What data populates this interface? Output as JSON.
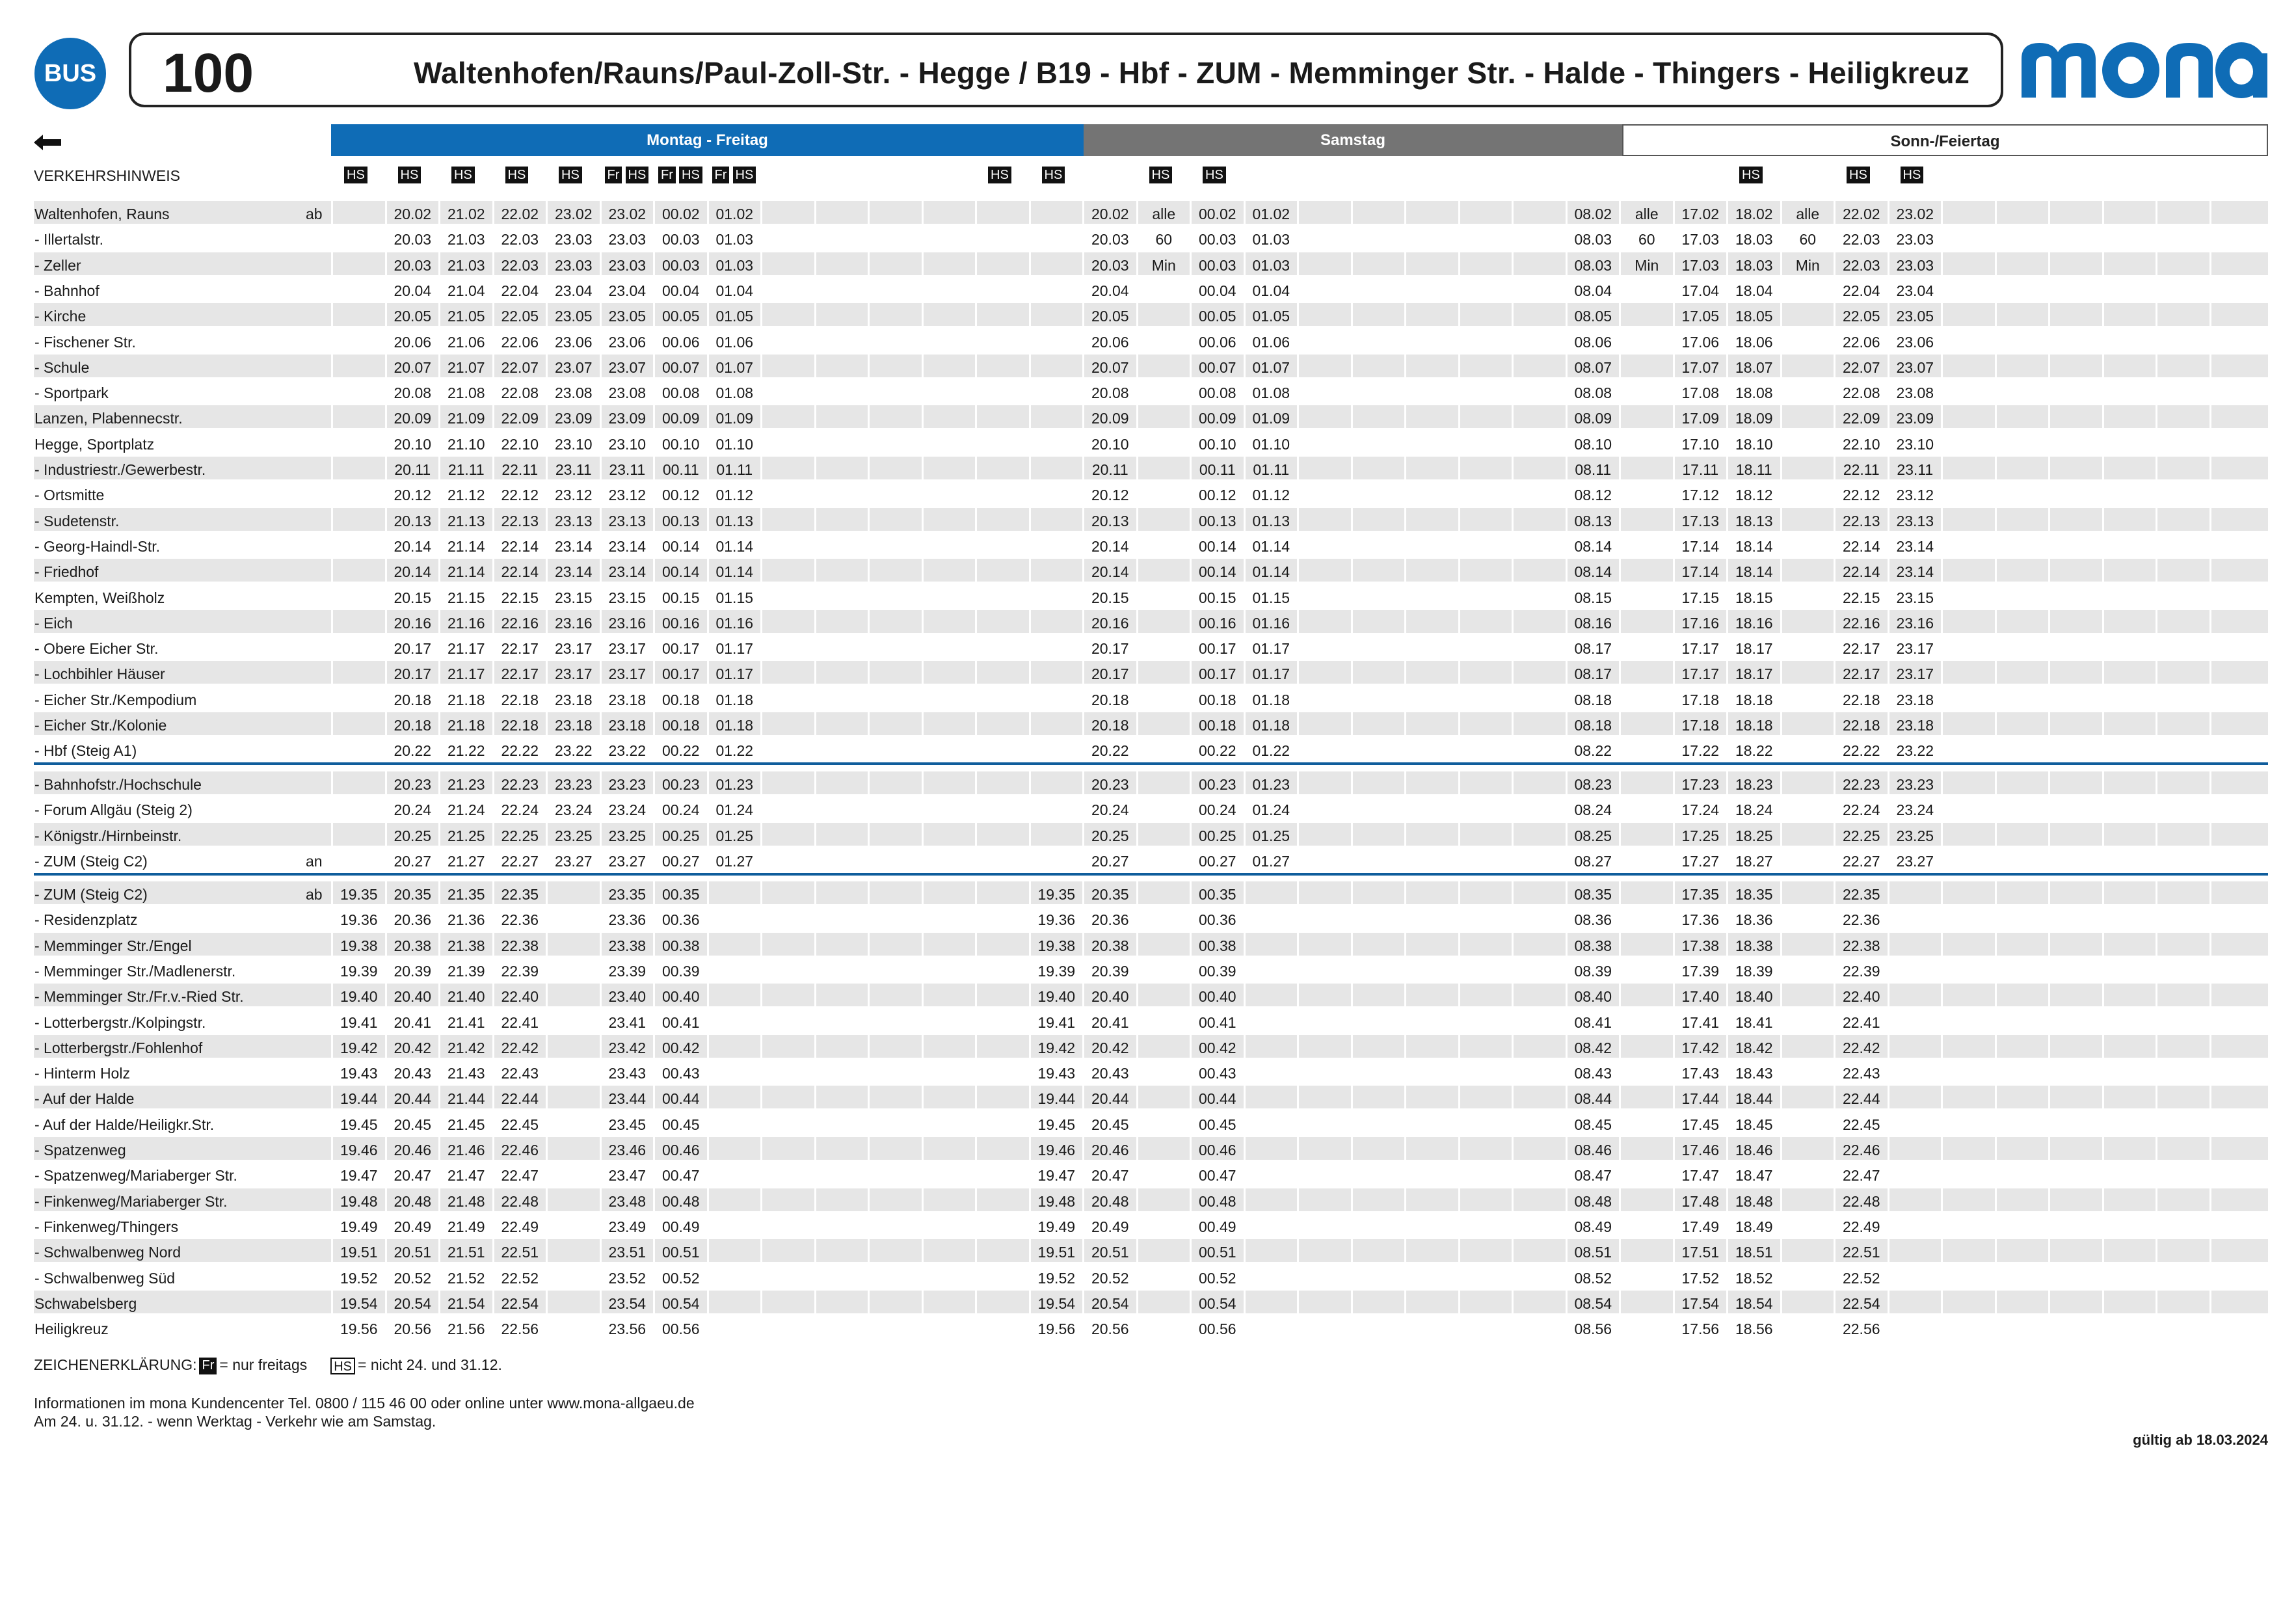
{
  "header": {
    "badge": "BUS",
    "line_number": "100",
    "route_title": "Waltenhofen/Rauns/Paul-Zoll-Str. - Hegge / B19 - Hbf - ZUM - Memminger Str. - Halde - Thingers - Heiligkreuz",
    "brand": "mona",
    "brand_color": "#0f6cb6"
  },
  "day_headers": {
    "weekday": "Montag - Freitag",
    "saturday": "Samstag",
    "sunday": "Sonn-/Feiertag"
  },
  "notes_label": "VERKEHRSHINWEIS",
  "hs_tag": "HS",
  "fr_tag": "Fr",
  "stops": [
    "Waltenhofen, Rauns",
    "- Illertalstr.",
    "- Zeller",
    "- Bahnhof",
    "- Kirche",
    "- Fischener Str.",
    "- Schule",
    "- Sportpark",
    "Lanzen, Plabennecstr.",
    "Hegge, Sportplatz",
    "- Industriestr./Gewerbestr.",
    "- Ortsmitte",
    "- Sudetenstr.",
    "- Georg-Haindl-Str.",
    "- Friedhof",
    "Kempten, Weißholz",
    "- Eich",
    "- Obere Eicher Str.",
    "- Lochbihler Häuser",
    "- Eicher Str./Kempodium",
    "- Eicher Str./Kolonie",
    "- Hbf (Steig A1)",
    "- Bahnhofstr./Hochschule",
    "- Forum Allgäu (Steig 2)",
    "- Königstr./Hirnbeinstr.",
    "- ZUM (Steig C2)",
    "- ZUM (Steig C2)",
    "- Residenzplatz",
    "- Memminger Str./Engel",
    "- Memminger Str./Madlenerstr.",
    "- Memminger Str./Fr.v.-Ried Str.",
    "- Lotterbergstr./Kolpingstr.",
    "- Lotterbergstr./Fohlenhof",
    "- Hinterm Holz",
    "- Auf der Halde",
    "- Auf der Halde/Heiligkr.Str.",
    "- Spatzenweg",
    "- Spatzenweg/Mariaberger Str.",
    "- Finkenweg/Mariaberger Str.",
    "- Finkenweg/Thingers",
    "- Schwalbenweg Nord",
    "- Schwalbenweg Süd",
    "Schwabelsberg",
    "Heiligkreuz"
  ],
  "ab_an": [
    "ab",
    "",
    "",
    "",
    "",
    "",
    "",
    "",
    "",
    "",
    "",
    "",
    "",
    "",
    "",
    "",
    "",
    "",
    "",
    "",
    "",
    "",
    "",
    "",
    "",
    "an",
    "ab",
    "",
    "",
    "",
    "",
    "",
    "",
    "",
    "",
    "",
    "",
    "",
    "",
    "",
    "",
    "",
    "",
    ""
  ],
  "weekday_times": [
    [
      "20.02",
      "20.03",
      "20.03",
      "20.04",
      "20.05",
      "20.06",
      "20.07",
      "20.08",
      "20.09",
      "20.10",
      "20.11",
      "20.12",
      "20.13",
      "20.14",
      "20.14",
      "20.15",
      "20.16",
      "20.17",
      "20.17",
      "20.18",
      "20.18",
      "20.22",
      "20.23",
      "20.24",
      "20.25",
      "20.27",
      "20.35",
      "20.36",
      "20.38",
      "20.39",
      "20.40",
      "20.41",
      "20.42",
      "20.43",
      "20.44",
      "20.45",
      "20.46",
      "20.47",
      "20.48",
      "20.49",
      "20.51",
      "20.52",
      "20.54",
      "20.56"
    ],
    [
      "21.02",
      "21.03",
      "21.03",
      "21.04",
      "21.05",
      "21.06",
      "21.07",
      "21.08",
      "21.09",
      "21.10",
      "21.11",
      "21.12",
      "21.13",
      "21.14",
      "21.14",
      "21.15",
      "21.16",
      "21.17",
      "21.17",
      "21.18",
      "21.18",
      "21.22",
      "21.23",
      "21.24",
      "21.25",
      "21.27",
      "21.35",
      "21.36",
      "21.38",
      "21.39",
      "21.40",
      "21.41",
      "21.42",
      "21.43",
      "21.44",
      "21.45",
      "21.46",
      "21.47",
      "21.48",
      "21.49",
      "21.51",
      "21.52",
      "21.54",
      "21.56"
    ],
    [
      "22.02",
      "22.03",
      "22.03",
      "22.04",
      "22.05",
      "22.06",
      "22.07",
      "22.08",
      "22.09",
      "22.10",
      "22.11",
      "22.12",
      "22.13",
      "22.14",
      "22.14",
      "22.15",
      "22.16",
      "22.17",
      "22.17",
      "22.18",
      "22.18",
      "22.22",
      "22.23",
      "22.24",
      "22.25",
      "22.27",
      "22.35",
      "22.36",
      "22.38",
      "22.39",
      "22.40",
      "22.41",
      "22.42",
      "22.43",
      "22.44",
      "22.45",
      "22.46",
      "22.47",
      "22.48",
      "22.49",
      "22.51",
      "22.52",
      "22.54",
      "22.56"
    ],
    [
      "23.02",
      "23.03",
      "23.03",
      "23.04",
      "23.05",
      "23.06",
      "23.07",
      "23.08",
      "23.09",
      "23.10",
      "23.11",
      "23.12",
      "23.13",
      "23.14",
      "23.14",
      "23.15",
      "23.16",
      "23.17",
      "23.17",
      "23.18",
      "23.18",
      "23.22",
      "23.23",
      "23.24",
      "23.25",
      "23.27",
      "",
      "",
      "",
      "",
      "",
      "",
      "",
      "",
      "",
      "",
      "",
      "",
      "",
      "",
      "",
      "",
      "",
      ""
    ],
    [
      "23.02",
      "23.03",
      "23.03",
      "23.04",
      "23.05",
      "23.06",
      "23.07",
      "23.08",
      "23.09",
      "23.10",
      "23.11",
      "23.12",
      "23.13",
      "23.14",
      "23.14",
      "23.15",
      "23.16",
      "23.17",
      "23.17",
      "23.18",
      "23.18",
      "23.22",
      "23.23",
      "23.24",
      "23.25",
      "23.27",
      "23.35",
      "23.36",
      "23.38",
      "23.39",
      "23.40",
      "23.41",
      "23.42",
      "23.43",
      "23.44",
      "23.45",
      "23.46",
      "23.47",
      "23.48",
      "23.49",
      "23.51",
      "23.52",
      "23.54",
      "23.56"
    ],
    [
      "00.02",
      "00.03",
      "00.03",
      "00.04",
      "00.05",
      "00.06",
      "00.07",
      "00.08",
      "00.09",
      "00.10",
      "00.11",
      "00.12",
      "00.13",
      "00.14",
      "00.14",
      "00.15",
      "00.16",
      "00.17",
      "00.17",
      "00.18",
      "00.18",
      "00.22",
      "00.23",
      "00.24",
      "00.25",
      "00.27",
      "00.35",
      "00.36",
      "00.38",
      "00.39",
      "00.40",
      "00.41",
      "00.42",
      "00.43",
      "00.44",
      "00.45",
      "00.46",
      "00.47",
      "00.48",
      "00.49",
      "00.51",
      "00.52",
      "00.54",
      "00.56"
    ],
    [
      "01.02",
      "01.03",
      "01.03",
      "01.04",
      "01.05",
      "01.06",
      "01.07",
      "01.08",
      "01.09",
      "01.10",
      "01.11",
      "01.12",
      "01.13",
      "01.14",
      "01.14",
      "01.15",
      "01.16",
      "01.17",
      "01.17",
      "01.18",
      "01.18",
      "01.22",
      "01.23",
      "01.24",
      "01.25",
      "01.27",
      "",
      "",
      "",
      "",
      "",
      "",
      "",
      "",
      "",
      "",
      "",
      "",
      "",
      "",
      "",
      "",
      "",
      ""
    ]
  ],
  "weekday_early": [
    "",
    "",
    "",
    "",
    "",
    "",
    "",
    "",
    "",
    "",
    "",
    "",
    "",
    "",
    "",
    "",
    "",
    "",
    "",
    "",
    "",
    "",
    "",
    "",
    "",
    "",
    "19.35",
    "19.36",
    "19.38",
    "19.39",
    "19.40",
    "19.41",
    "19.42",
    "19.43",
    "19.44",
    "19.45",
    "19.46",
    "19.47",
    "19.48",
    "19.49",
    "19.51",
    "19.52",
    "19.54",
    "19.56"
  ],
  "saturday_times": [
    [
      "",
      "",
      "",
      "",
      "",
      "",
      "",
      "",
      "",
      "",
      "",
      "",
      "",
      "",
      "",
      "",
      "",
      "",
      "",
      "",
      "",
      "",
      "",
      "",
      "",
      "",
      "19.35",
      "19.36",
      "19.38",
      "19.39",
      "19.40",
      "19.41",
      "19.42",
      "19.43",
      "19.44",
      "19.45",
      "19.46",
      "19.47",
      "19.48",
      "19.49",
      "19.51",
      "19.52",
      "19.54",
      "19.56"
    ],
    [
      "20.02",
      "20.03",
      "20.03",
      "20.04",
      "20.05",
      "20.06",
      "20.07",
      "20.08",
      "20.09",
      "20.10",
      "20.11",
      "20.12",
      "20.13",
      "20.14",
      "20.14",
      "20.15",
      "20.16",
      "20.17",
      "20.17",
      "20.18",
      "20.18",
      "20.22",
      "20.23",
      "20.24",
      "20.25",
      "20.27",
      "20.35",
      "20.36",
      "20.38",
      "20.39",
      "20.40",
      "20.41",
      "20.42",
      "20.43",
      "20.44",
      "20.45",
      "20.46",
      "20.47",
      "20.48",
      "20.49",
      "20.51",
      "20.52",
      "20.54",
      "20.56"
    ],
    [
      "alle",
      "60",
      "Min",
      "",
      "",
      "",
      "",
      "",
      "",
      "",
      "",
      "",
      "",
      "",
      "",
      "",
      "",
      "",
      "",
      "",
      "",
      "",
      "",
      "",
      "",
      "",
      "",
      "",
      "",
      "",
      "",
      "",
      "",
      "",
      "",
      "",
      "",
      "",
      "",
      "",
      "",
      "",
      "",
      ""
    ],
    [
      "00.02",
      "00.03",
      "00.03",
      "00.04",
      "00.05",
      "00.06",
      "00.07",
      "00.08",
      "00.09",
      "00.10",
      "00.11",
      "00.12",
      "00.13",
      "00.14",
      "00.14",
      "00.15",
      "00.16",
      "00.17",
      "00.17",
      "00.18",
      "00.18",
      "00.22",
      "00.23",
      "00.24",
      "00.25",
      "00.27",
      "00.35",
      "00.36",
      "00.38",
      "00.39",
      "00.40",
      "00.41",
      "00.42",
      "00.43",
      "00.44",
      "00.45",
      "00.46",
      "00.47",
      "00.48",
      "00.49",
      "00.51",
      "00.52",
      "00.54",
      "00.56"
    ],
    [
      "01.02",
      "01.03",
      "01.03",
      "01.04",
      "01.05",
      "01.06",
      "01.07",
      "01.08",
      "01.09",
      "01.10",
      "01.11",
      "01.12",
      "01.13",
      "01.14",
      "01.14",
      "01.15",
      "01.16",
      "01.17",
      "01.17",
      "01.18",
      "01.18",
      "01.22",
      "01.23",
      "01.24",
      "01.25",
      "01.27",
      "",
      "",
      "",
      "",
      "",
      "",
      "",
      "",
      "",
      "",
      "",
      "",
      "",
      "",
      "",
      "",
      "",
      ""
    ]
  ],
  "sunday_times": [
    [
      "08.02",
      "08.03",
      "08.03",
      "08.04",
      "08.05",
      "08.06",
      "08.07",
      "08.08",
      "08.09",
      "08.10",
      "08.11",
      "08.12",
      "08.13",
      "08.14",
      "08.14",
      "08.15",
      "08.16",
      "08.17",
      "08.17",
      "08.18",
      "08.18",
      "08.22",
      "08.23",
      "08.24",
      "08.25",
      "08.27",
      "08.35",
      "08.36",
      "08.38",
      "08.39",
      "08.40",
      "08.41",
      "08.42",
      "08.43",
      "08.44",
      "08.45",
      "08.46",
      "08.47",
      "08.48",
      "08.49",
      "08.51",
      "08.52",
      "08.54",
      "08.56"
    ],
    [
      "alle",
      "60",
      "Min",
      "",
      "",
      "",
      "",
      "",
      "",
      "",
      "",
      "",
      "",
      "",
      "",
      "",
      "",
      "",
      "",
      "",
      "",
      "",
      "",
      "",
      "",
      "",
      "",
      "",
      "",
      "",
      "",
      "",
      "",
      "",
      "",
      "",
      "",
      "",
      "",
      "",
      "",
      "",
      "",
      ""
    ],
    [
      "17.02",
      "17.03",
      "17.03",
      "17.04",
      "17.05",
      "17.06",
      "17.07",
      "17.08",
      "17.09",
      "17.10",
      "17.11",
      "17.12",
      "17.13",
      "17.14",
      "17.14",
      "17.15",
      "17.16",
      "17.17",
      "17.17",
      "17.18",
      "17.18",
      "17.22",
      "17.23",
      "17.24",
      "17.25",
      "17.27",
      "17.35",
      "17.36",
      "17.38",
      "17.39",
      "17.40",
      "17.41",
      "17.42",
      "17.43",
      "17.44",
      "17.45",
      "17.46",
      "17.47",
      "17.48",
      "17.49",
      "17.51",
      "17.52",
      "17.54",
      "17.56"
    ],
    [
      "18.02",
      "18.03",
      "18.03",
      "18.04",
      "18.05",
      "18.06",
      "18.07",
      "18.08",
      "18.09",
      "18.10",
      "18.11",
      "18.12",
      "18.13",
      "18.14",
      "18.14",
      "18.15",
      "18.16",
      "18.17",
      "18.17",
      "18.18",
      "18.18",
      "18.22",
      "18.23",
      "18.24",
      "18.25",
      "18.27",
      "18.35",
      "18.36",
      "18.38",
      "18.39",
      "18.40",
      "18.41",
      "18.42",
      "18.43",
      "18.44",
      "18.45",
      "18.46",
      "18.47",
      "18.48",
      "18.49",
      "18.51",
      "18.52",
      "18.54",
      "18.56"
    ],
    [
      "alle",
      "60",
      "Min",
      "",
      "",
      "",
      "",
      "",
      "",
      "",
      "",
      "",
      "",
      "",
      "",
      "",
      "",
      "",
      "",
      "",
      "",
      "",
      "",
      "",
      "",
      "",
      "",
      "",
      "",
      "",
      "",
      "",
      "",
      "",
      "",
      "",
      "",
      "",
      "",
      "",
      "",
      "",
      "",
      ""
    ],
    [
      "22.02",
      "22.03",
      "22.03",
      "22.04",
      "22.05",
      "22.06",
      "22.07",
      "22.08",
      "22.09",
      "22.10",
      "22.11",
      "22.12",
      "22.13",
      "22.14",
      "22.14",
      "22.15",
      "22.16",
      "22.17",
      "22.17",
      "22.18",
      "22.18",
      "22.22",
      "22.23",
      "22.24",
      "22.25",
      "22.27",
      "22.35",
      "22.36",
      "22.38",
      "22.39",
      "22.40",
      "22.41",
      "22.42",
      "22.43",
      "22.44",
      "22.45",
      "22.46",
      "22.47",
      "22.48",
      "22.49",
      "22.51",
      "22.52",
      "22.54",
      "22.56"
    ],
    [
      "23.02",
      "23.03",
      "23.03",
      "23.04",
      "23.05",
      "23.06",
      "23.07",
      "23.08",
      "23.09",
      "23.10",
      "23.11",
      "23.12",
      "23.13",
      "23.14",
      "23.14",
      "23.15",
      "23.16",
      "23.17",
      "23.17",
      "23.18",
      "23.18",
      "23.22",
      "23.23",
      "23.24",
      "23.25",
      "23.27",
      "",
      "",
      "",
      "",
      "",
      "",
      "",
      "",
      "",
      "",
      "",
      "",
      "",
      "",
      "",
      "",
      "",
      ""
    ]
  ],
  "legend": {
    "prefix": "ZEICHENERKLÄRUNG:",
    "fr_text": "= nur freitags",
    "hs_text": "= nicht 24. und 31.12."
  },
  "info_line1": "Informationen im mona Kundencenter Tel. 0800 / 115 46 00 oder online unter www.mona-allgaeu.de",
  "info_line2": "Am 24. u. 31.12. - wenn Werktag - Verkehr wie am Samstag.",
  "valid_from": "gültig ab 18.03.2024"
}
